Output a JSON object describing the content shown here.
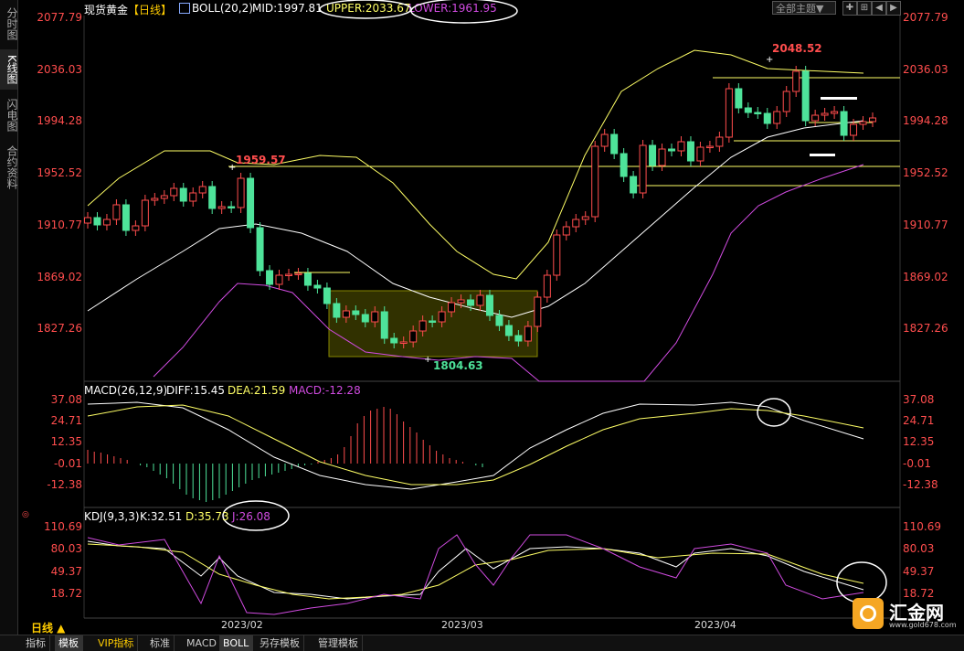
{
  "sidebar": {
    "tabs": [
      {
        "label": "分时图"
      },
      {
        "label": "K线图"
      },
      {
        "label": "闪电图"
      },
      {
        "label": "合约资料"
      }
    ]
  },
  "header": {
    "symbol": "现货黄金",
    "period": "【日线】",
    "indicator": "BOLL(20,2)",
    "mid": "MID:1997.81",
    "upper": "UPPER:2033.67",
    "lower": "LOWER:1961.95",
    "theme_button": "全部主题▼"
  },
  "price_axis": [
    "2077.79",
    "2036.03",
    "1994.28",
    "1952.52",
    "1910.77",
    "1869.02",
    "1827.26"
  ],
  "macd_panel": {
    "title": "MACD(26,12,9)",
    "diff": "DIFF:15.45",
    "dea": "DEA:21.59",
    "macd": "MACD:-12.28",
    "axis": [
      "37.08",
      "24.71",
      "12.35",
      "-0.01",
      "-12.38"
    ]
  },
  "kdj_panel": {
    "title": "KDJ(9,3,3)",
    "k": "K:32.51",
    "d": "D:35.73",
    "j": "J:26.08",
    "axis": [
      "110.69",
      "80.03",
      "49.37",
      "18.72"
    ]
  },
  "annotations": {
    "high_label": "2048.52",
    "peak_label": "1959.57",
    "low_label": "1804.63"
  },
  "dates": [
    "2023/02",
    "2023/03",
    "2023/04"
  ],
  "period_selector": "日线 ▲",
  "bottom_tabs": [
    "指标",
    "模板",
    "VIP指标",
    "标准",
    "MACD",
    "BOLL",
    "另存模板",
    "管理模板"
  ],
  "logo": {
    "name": "汇金网",
    "url": "www.gold678.com"
  },
  "colors": {
    "up": "#ff4d4d",
    "down": "#4ee39a",
    "mid_line": "#ffffff",
    "upper_line": "#ffff66",
    "lower_line": "#d04be0",
    "support_line": "#ffff66"
  },
  "chart_data": [
    {
      "type": "candlestick",
      "title": "现货黄金 日线 BOLL(20,2)",
      "x": [
        "2023/02",
        "2023/03",
        "2023/04"
      ],
      "ylim": [
        1804.63,
        2077.79
      ],
      "series": [
        {
          "name": "MID",
          "values": [
            1997.81
          ]
        },
        {
          "name": "UPPER",
          "values": [
            2033.67
          ]
        },
        {
          "name": "LOWER",
          "values": [
            1961.95
          ]
        }
      ]
    },
    {
      "type": "line",
      "title": "MACD(26,12,9)",
      "series": [
        {
          "name": "DIFF",
          "values": [
            15.45
          ]
        },
        {
          "name": "DEA",
          "values": [
            21.59
          ]
        },
        {
          "name": "MACD",
          "values": [
            -12.28
          ]
        }
      ],
      "ylim": [
        -12.38,
        37.08
      ]
    },
    {
      "type": "line",
      "title": "KDJ(9,3,3)",
      "series": [
        {
          "name": "K",
          "values": [
            32.51
          ]
        },
        {
          "name": "D",
          "values": [
            35.73
          ]
        },
        {
          "name": "J",
          "values": [
            26.08
          ]
        }
      ],
      "ylim": [
        18.72,
        110.69
      ]
    }
  ]
}
